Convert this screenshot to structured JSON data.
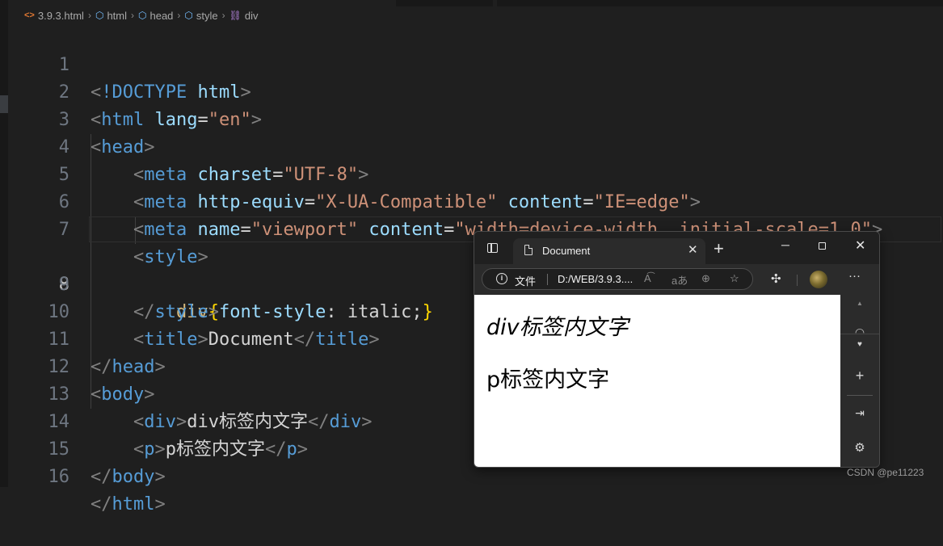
{
  "breadcrumb": {
    "file": "3.9.3.html",
    "items": [
      "html",
      "head",
      "style",
      "div"
    ]
  },
  "editor": {
    "current_line": 8,
    "lines": [
      {
        "num": "1"
      },
      {
        "num": "2"
      },
      {
        "num": "3"
      },
      {
        "num": "4"
      },
      {
        "num": "5"
      },
      {
        "num": "6"
      },
      {
        "num": "7"
      },
      {
        "num": "8"
      },
      {
        "num": "9"
      },
      {
        "num": "10"
      },
      {
        "num": "11"
      },
      {
        "num": "12"
      },
      {
        "num": "13"
      },
      {
        "num": "14"
      },
      {
        "num": "15"
      },
      {
        "num": "16"
      }
    ],
    "code": {
      "l1_doctype": "!DOCTYPE",
      "l1_html": "html",
      "l2_tag": "html",
      "l2_attr": "lang",
      "l2_val": "\"en\"",
      "l3_tag": "head",
      "meta": "meta",
      "charset": "charset",
      "charset_val": "\"UTF-8\"",
      "http_equiv": "http-equiv",
      "http_equiv_val": "\"X-UA-Compatible\"",
      "content": "content",
      "ie_edge": "\"IE=edge\"",
      "name": "name",
      "viewport_val": "\"viewport\"",
      "viewport_content": "\"width=device-width, initial-scale=1.0\"",
      "style": "style",
      "css_selector": "div",
      "css_prop": "font-style",
      "css_value": "italic",
      "title_tag": "title",
      "title_text": "Document",
      "head": "head",
      "body": "body",
      "div": "div",
      "div_text": "div标签内文字",
      "p": "p",
      "p_text": "p标签内文字",
      "html": "html"
    }
  },
  "browser": {
    "tab_title": "Document",
    "address_label": "文件",
    "url": "D:/WEB/3.9.3....",
    "page": {
      "div_text": "div标签内文字",
      "p_text": "p标签内文字"
    }
  },
  "icons": {
    "tab_actions": "tab-actions-icon",
    "info": "info-icon",
    "read_aloud": "read-aloud-icon",
    "translate": "translate-icon",
    "zoom": "zoom-icon",
    "favorite": "favorite-icon",
    "extensions": "extensions-icon",
    "more": "more-icon"
  },
  "watermark": "CSDN @pe11223",
  "colors": {
    "editor_bg": "#1f1f1f",
    "tag": "#569cd6",
    "attr": "#9cdcfe",
    "string": "#ce9178",
    "selector": "#d7ba7d",
    "bracket": "#ffd700"
  }
}
